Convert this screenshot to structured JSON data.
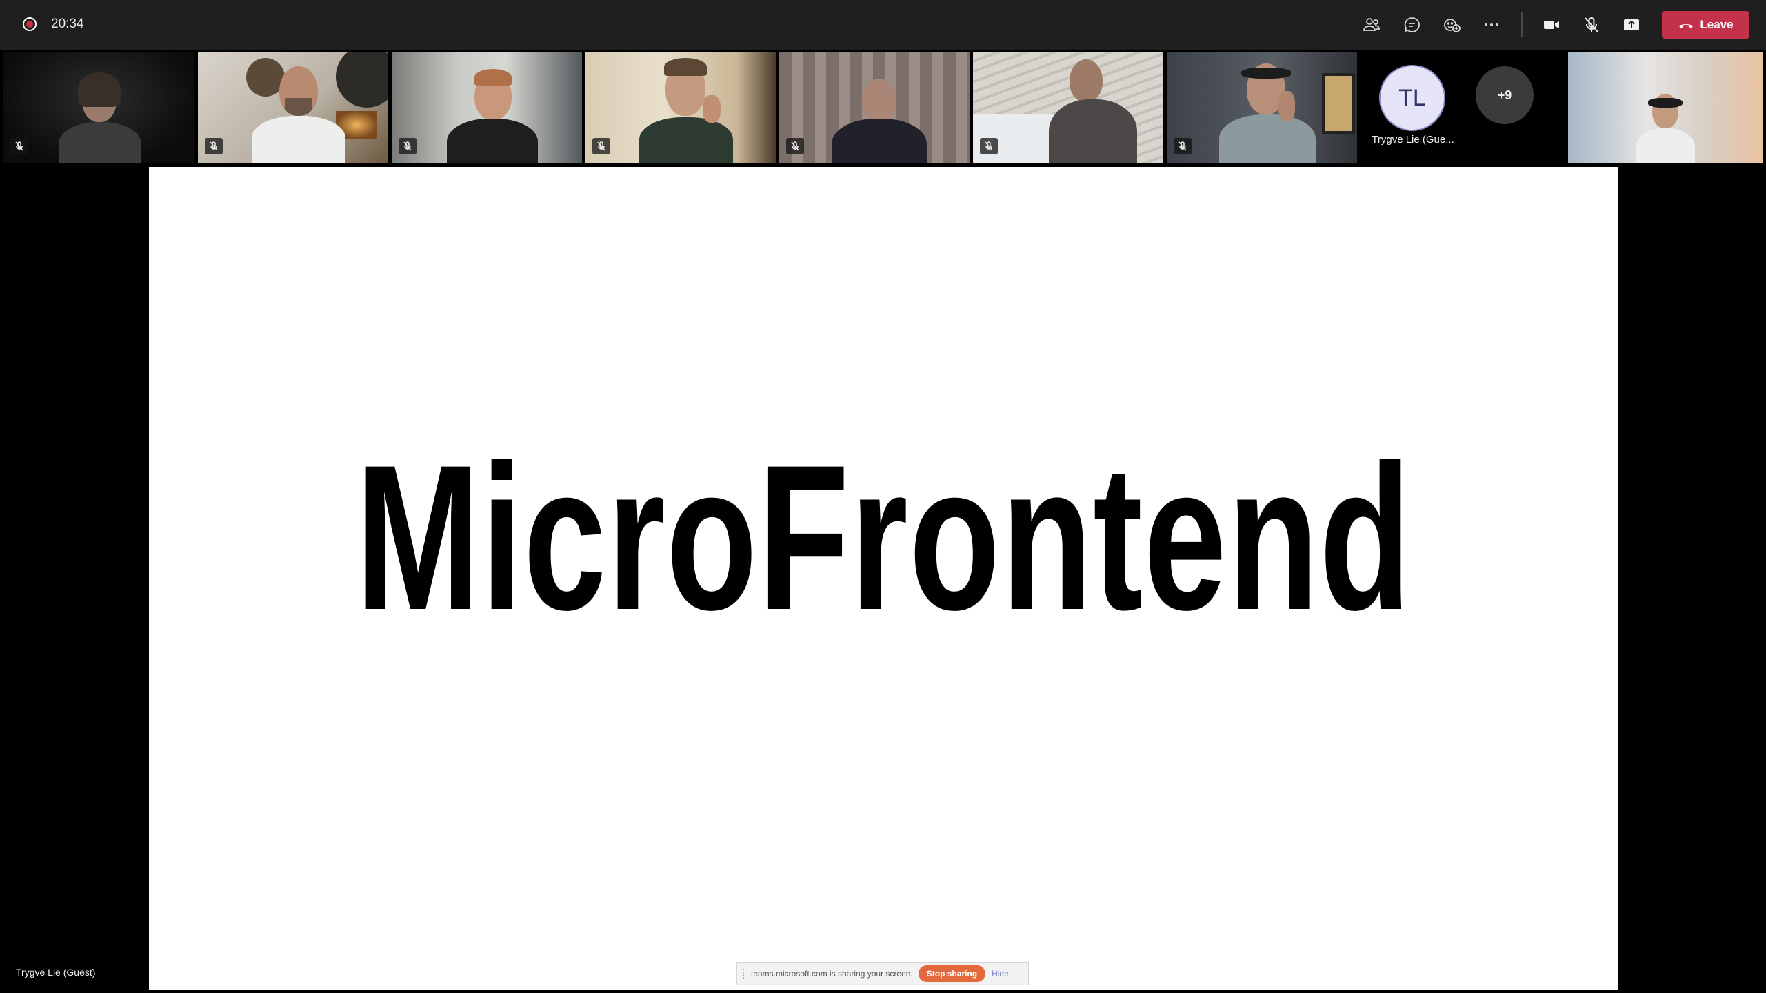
{
  "meeting": {
    "elapsed_time": "20:34",
    "leave_label": "Leave"
  },
  "toolbar": {
    "icons": [
      "people-icon",
      "chat-icon",
      "react-icon",
      "more-icon",
      "camera-icon",
      "mic-muted-icon",
      "share-icon"
    ]
  },
  "participants": {
    "avatar_initials": "TL",
    "avatar_name": "Trygve Lie (Gue...",
    "overflow_count": "+9"
  },
  "shared_screen": {
    "slide_title": "MicroFrontend",
    "presenter": "Trygve Lie (Guest)",
    "share_notice": "teams.microsoft.com is sharing your screen.",
    "stop_sharing_label": "Stop sharing",
    "hide_label": "Hide"
  },
  "colors": {
    "leave": "#c4314b",
    "topbar": "#1f1f1f",
    "stop_sharing": "#e3683b"
  }
}
